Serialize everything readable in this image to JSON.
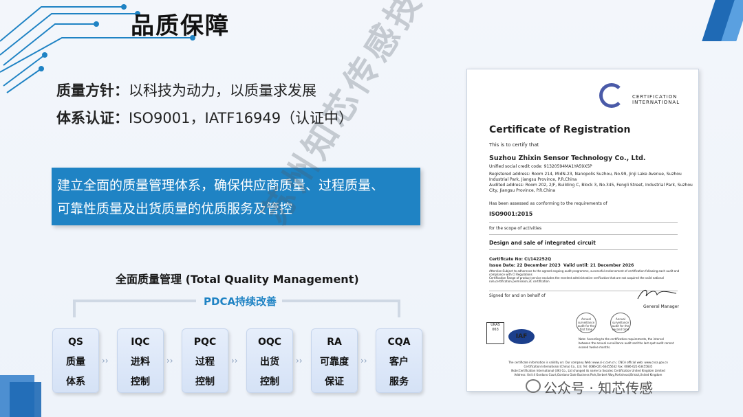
{
  "title": "品质保障",
  "policy": {
    "quality_label": "质量方针：",
    "quality_value": "以科技为动力，以质量求发展",
    "system_label": "体系认证：",
    "system_value": "ISO9001，IATF16949（认证中）"
  },
  "banner": {
    "line1": "建立全面的质量管理体系，确保供应商质量、过程质量、",
    "line2": "可靠性质量及出货质量的优质服务及管控"
  },
  "tqm": {
    "title": "全面质量管理 (Total Quality Management)",
    "pdca": "PDCA持续改善",
    "cards": [
      {
        "code": "QS",
        "l1": "质量",
        "l2": "体系"
      },
      {
        "code": "IQC",
        "l1": "进料",
        "l2": "控制"
      },
      {
        "code": "PQC",
        "l1": "过程",
        "l2": "控制"
      },
      {
        "code": "OQC",
        "l1": "出货",
        "l2": "控制"
      },
      {
        "code": "RA",
        "l1": "可靠度",
        "l2": "保证"
      },
      {
        "code": "CQA",
        "l1": "客户",
        "l2": "服务"
      }
    ]
  },
  "certificate": {
    "logo_line1": "CERTIFICATION",
    "logo_line2": "INTERNATIONAL",
    "heading": "Certificate of Registration",
    "certify": "This is to certify that",
    "company": "Suzhou Zhixin Sensor Technology Co., Ltd.",
    "credit_code": "Unified social credit code: 91320594MA1YA59X5P",
    "reg_addr1": "Registered address: Room 214, MidN-23, Nanopolis Suzhou, No.99, Jinji Lake Avenue, Suzhou",
    "reg_addr2": "Industrial Park, Jiangsu Province, P.R.China",
    "aud_addr1": "Audited address: Room 202, 2/F, Building C, Block 3, No.345, Fengli Street, Industrial Park, Suzhou",
    "aud_addr2": "City, Jiangsu Province, P.R.China",
    "assessed": "Has been assessed as conforming to the requirements of",
    "standard": "ISO9001:2015",
    "scope_label": "for the scope of activities",
    "scope": "Design and sale of integrated circuit",
    "cert_no": "Certificate No:  CI/142252Q",
    "issue_date": "Issue Date:  22 December 2023",
    "valid_until": "Valid until:  21 December 2026",
    "attention1": "Attention:Subject to adherence to the agreed ongoing audit programme, successful endorsement of certification following each audit and",
    "attention2": "compliance with CI Regulations",
    "attention3": "Certification Range of product service excludes the revelent administrative verification that are not acquired the valid national",
    "attention4": "rule,certification permission,3C certification",
    "signed": "Signed for and on behalf of",
    "gm": "General Manager",
    "stamp1": "Annual surveillance audit for the first time",
    "stamp2": "Annual surveillance audit for the second time",
    "note1": "Note:  According to the certification requirements, the interval",
    "note2": "between the annual surveillance audit and the last spot audit cannot",
    "note3": "exceed twelve months.",
    "ukas": "UKAS",
    "ukas_no": "063",
    "iaf": "IAF",
    "footer1": "The certificate information is validity on: Our company Web: www.ci-c.com.cn ; CNCA official web: www.cnca.gov.cn",
    "footer2": "Certification International (China) Co., Ltd. Tel: 0086-021-63455632 Fax: 0086-021-63455635",
    "footer3": "Note:Certification International (UK) Co., Ltd changed its name to Socotec Certification United Kingdom Limited",
    "footer4": "Address: Unit 4 Gordano Court,Gordano Gate Business Park,Serbert Way,Portishead,Bristol,United Kingdom"
  },
  "watermark": "苏州知芯传感技术有限公司",
  "footer": "公众号 · 知芯传感",
  "colors": {
    "accent": "#1f83c4",
    "title": "#111111"
  }
}
